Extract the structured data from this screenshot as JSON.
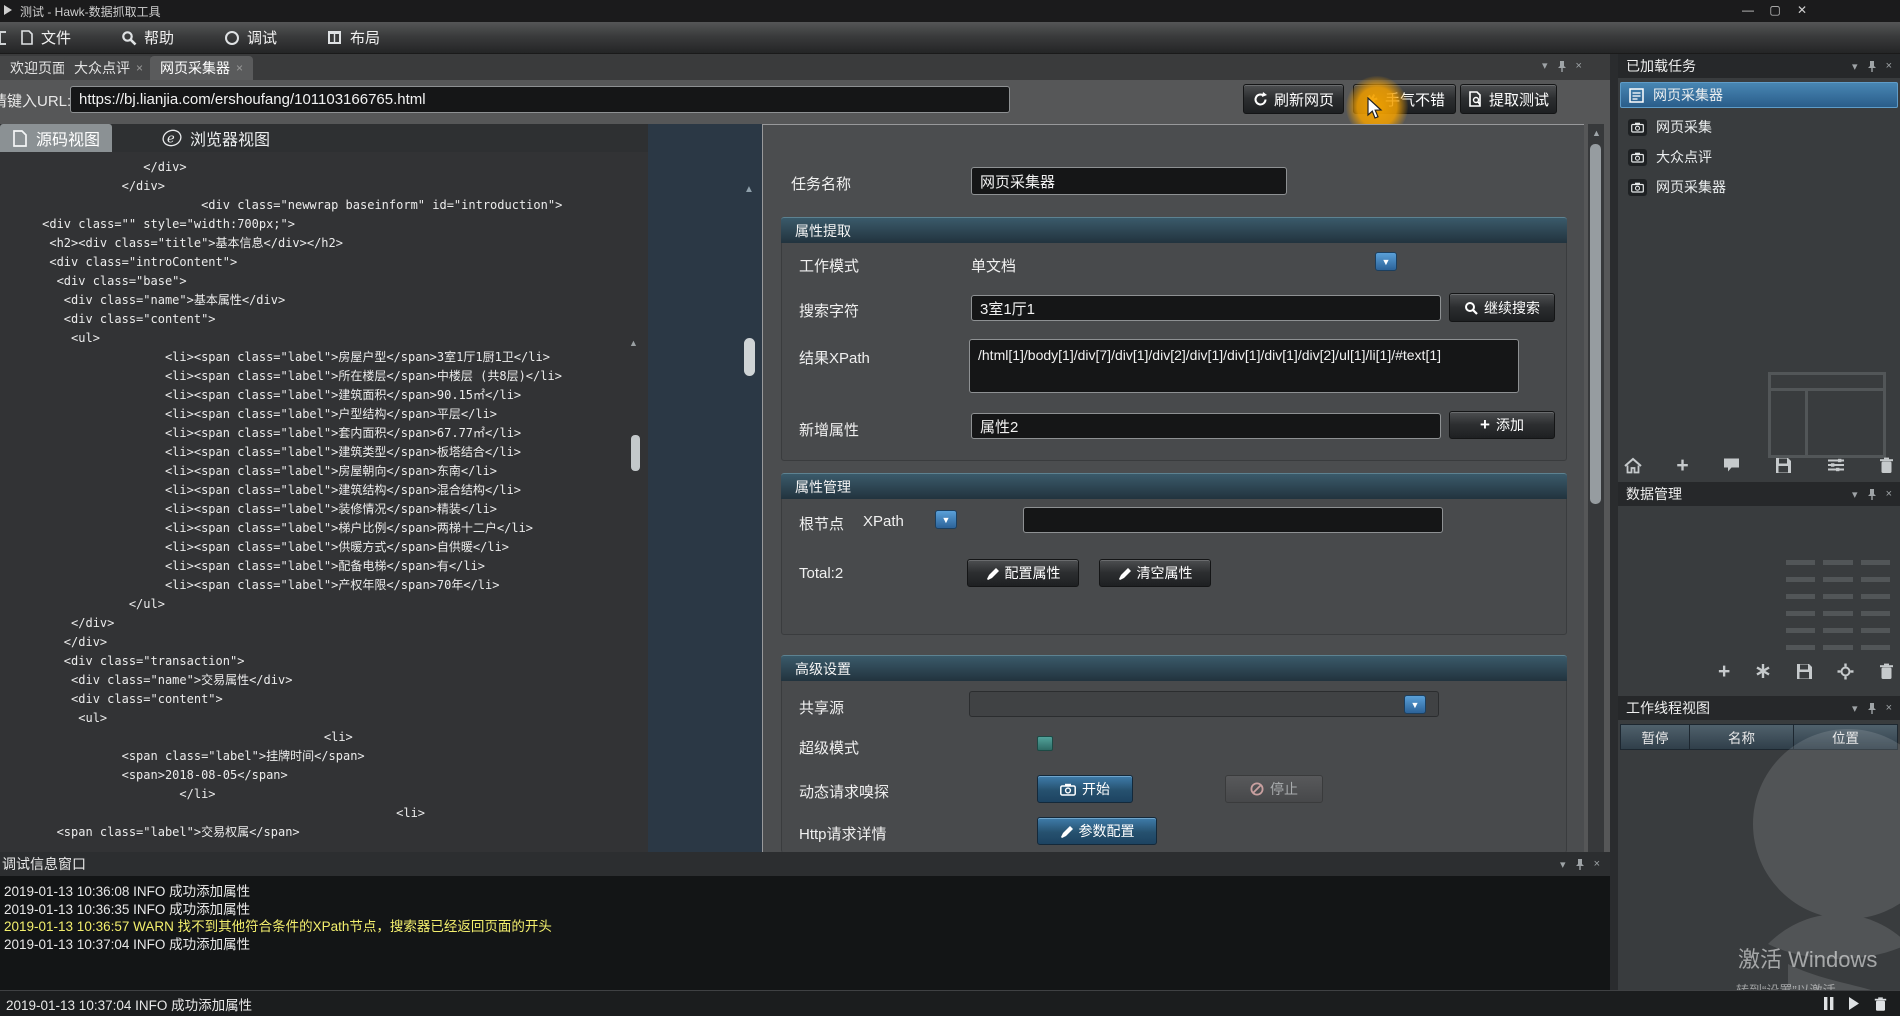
{
  "window": {
    "title": "测试 - Hawk-数据抓取工具",
    "controls": {
      "min": "—",
      "max": "▢",
      "close": "✕"
    }
  },
  "ui_icons": {
    "caret": "▾",
    "close": "×",
    "chevron_down": "▼",
    "up_arrow": "▲",
    "plus": "+"
  },
  "menu": {
    "items": [
      {
        "label": "文件"
      },
      {
        "label": "帮助"
      },
      {
        "label": "调试"
      },
      {
        "label": "布局"
      }
    ]
  },
  "tabs": {
    "items": [
      {
        "label": "欢迎页面",
        "close": ""
      },
      {
        "label": "大众点评",
        "close": "×"
      },
      {
        "label": "网页采集器",
        "close": "×"
      }
    ]
  },
  "url_bar": {
    "label": "请键入URL:",
    "value": "https://bj.lianjia.com/ershoufang/101103166765.html",
    "refresh_label": "刷新网页",
    "lucky_label": "手气不错",
    "extract_label": "提取测试"
  },
  "source_panel": {
    "source_tab": "源码视图",
    "browser_tab": "浏览器视图",
    "code_lines": [
      "                   </div>",
      "                </div>",
      "                           <div class=\"newwrap baseinform\" id=\"introduction\">",
      "     <div class=\"\" style=\"width:700px;\">",
      "      <h2><div class=\"title\">基本信息</div></h2>",
      "      <div class=\"introContent\">",
      "       <div class=\"base\">",
      "        <div class=\"name\">基本属性</div>",
      "        <div class=\"content\">",
      "         <ul>",
      "                      <li><span class=\"label\">房屋户型</span>3室1厅1厨1卫</li>",
      "                      <li><span class=\"label\">所在楼层</span>中楼层 (共8层)</li>",
      "                      <li><span class=\"label\">建筑面积</span>90.15㎡</li>",
      "                      <li><span class=\"label\">户型结构</span>平层</li>",
      "                      <li><span class=\"label\">套内面积</span>67.77㎡</li>",
      "                      <li><span class=\"label\">建筑类型</span>板塔结合</li>",
      "                      <li><span class=\"label\">房屋朝向</span>东南</li>",
      "                      <li><span class=\"label\">建筑结构</span>混合结构</li>",
      "                      <li><span class=\"label\">装修情况</span>精装</li>",
      "                      <li><span class=\"label\">梯户比例</span>两梯十二户</li>",
      "                      <li><span class=\"label\">供暖方式</span>自供暖</li>",
      "                      <li><span class=\"label\">配备电梯</span>有</li>",
      "                      <li><span class=\"label\">产权年限</span>70年</li>",
      "                 </ul>",
      "         </div>",
      "        </div>",
      "        <div class=\"transaction\">",
      "         <div class=\"name\">交易属性</div>",
      "         <div class=\"content\">",
      "          <ul>",
      "                                            <li>",
      "                <span class=\"label\">挂牌时间</span>",
      "                <span>2018-08-05</span>",
      "                        </li>",
      "                                                      <li>",
      "       <span class=\"label\">交易权属</span>"
    ]
  },
  "task_form": {
    "task_name_label": "任务名称",
    "task_name_value": "网页采集器",
    "extract_section": {
      "title": "属性提取",
      "work_mode_label": "工作模式",
      "work_mode_value": "单文档",
      "search_label": "搜索字符",
      "search_value": "3室1厅1",
      "search_button": "继续搜索",
      "xpath_label": "结果XPath",
      "xpath_value": "/html[1]/body[1]/div[7]/div[1]/div[2]/div[1]/div[1]/div[1]/div[2]/ul[1]/li[1]/#text[1]",
      "new_attr_label": "新增属性",
      "new_attr_value": "属性2",
      "add_button": "添加"
    },
    "manage_section": {
      "title": "属性管理",
      "root_label": "根节点",
      "root_mode": "XPath",
      "root_value": "",
      "total_label": "Total:2",
      "config_button": "配置属性",
      "clear_button": "清空属性"
    },
    "advanced_section": {
      "title": "高级设置",
      "share_label": "共享源",
      "share_value": "",
      "super_label": "超级模式",
      "sniff_label": "动态请求嗅探",
      "start_button": "开始",
      "stop_button": "停止",
      "http_label": "Http请求详情",
      "param_button": "参数配置"
    }
  },
  "sidebar": {
    "tasks_title": "已加载任务",
    "selected_task": "网页采集器",
    "task_items": [
      {
        "label": "网页采集"
      },
      {
        "label": "大众点评"
      },
      {
        "label": "网页采集器"
      }
    ],
    "data_title": "数据管理",
    "worker_title": "工作线程视图",
    "worker_columns": [
      {
        "label": "暂停"
      },
      {
        "label": "名称"
      },
      {
        "label": "位置"
      }
    ]
  },
  "debug_panel": {
    "title": "调试信息窗口",
    "logs": [
      {
        "text": "2019-01-13 10:36:08 INFO  成功添加属性"
      },
      {
        "text": "2019-01-13 10:36:35 INFO  成功添加属性"
      },
      {
        "text": "2019-01-13 10:36:57 WARN  找不到其他符合条件的XPath节点，搜索器已经返回页面的开头"
      },
      {
        "text": "2019-01-13 10:37:04 INFO  成功添加属性"
      }
    ],
    "status_text": "2019-01-13 10:37:04 INFO  成功添加属性"
  },
  "watermark": {
    "line1": "激活 Windows",
    "line2": "转到“设置”以激活 Windows。"
  },
  "colors": {
    "accent_blue": "#3c76a4",
    "warn_yellow": "#f3ef6d",
    "highlight_orange": "#f0a500",
    "section_teal": "#2b4a5a"
  }
}
